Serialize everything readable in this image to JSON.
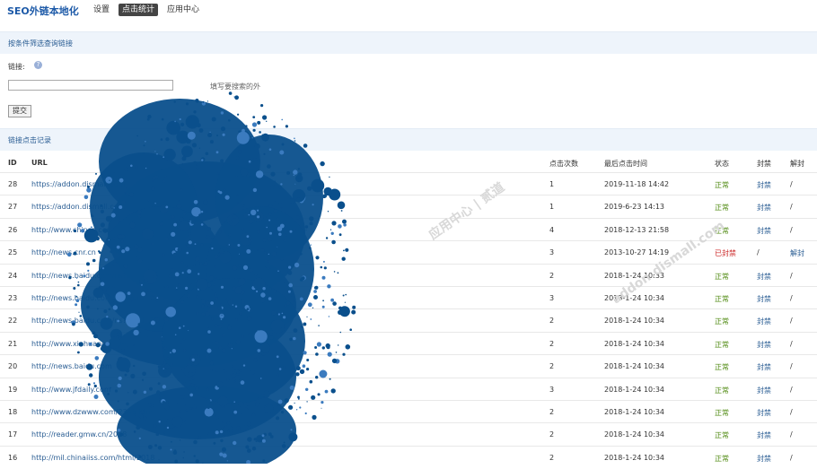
{
  "app": {
    "logo_prefix": "SEO",
    "logo_rest": "外链本地化"
  },
  "nav": {
    "items": [
      {
        "label": "设置",
        "active": false
      },
      {
        "label": "点击统计",
        "active": true
      },
      {
        "label": "应用中心",
        "active": false
      }
    ]
  },
  "filter": {
    "section_title": "按条件筛选查询链接",
    "link_label": "链接:",
    "input_value": "",
    "hint": "填写要搜索的外",
    "submit_label": "提交"
  },
  "records": {
    "section_title": "链接点击记录",
    "columns": [
      "ID",
      "URL",
      "点击次数",
      "最后点击时间",
      "状态",
      "封禁",
      "解封"
    ],
    "rows": [
      {
        "id": "28",
        "url": "https://addon.dismall.com",
        "clicks": "1",
        "last": "2019-11-18 14:42",
        "status": "正常",
        "status_type": "ok",
        "ban": "封禁",
        "unban": "/"
      },
      {
        "id": "27",
        "url": "https://addon.dismall.com",
        "clicks": "1",
        "last": "2019-6-23 14:13",
        "status": "正常",
        "status_type": "ok",
        "ban": "封禁",
        "unban": "/"
      },
      {
        "id": "26",
        "url": "http://www.chinaz.com",
        "clicks": "4",
        "last": "2018-12-13 21:58",
        "status": "正常",
        "status_type": "ok",
        "ban": "封禁",
        "unban": "/"
      },
      {
        "id": "25",
        "url": "http://news.cnr.cn",
        "clicks": "3",
        "last": "2013-10-27 14:19",
        "status": "已封禁",
        "status_type": "banned",
        "ban": "/",
        "unban": "解封"
      },
      {
        "id": "24",
        "url": "http://news.baidu.com/ns?word=%C4%B4%A8%2..",
        "clicks": "2",
        "last": "2018-1-24 10:33",
        "status": "正常",
        "status_type": "ok",
        "ban": "封禁",
        "unban": "/"
      },
      {
        "id": "23",
        "url": "http://news.baidu.com/ns?word=%E3%BB%C6%D..",
        "clicks": "3",
        "last": "2018-1-24 10:34",
        "status": "正常",
        "status_type": "ok",
        "ban": "封禁",
        "unban": "/"
      },
      {
        "id": "22",
        "url": "http://news.baidu.com/ns?word=%D0%C2%BF%EC%B..",
        "clicks": "2",
        "last": "2018-1-24 10:34",
        "status": "正常",
        "status_type": "ok",
        "ban": "封禁",
        "unban": "/"
      },
      {
        "id": "21",
        "url": "http://www.xinhuanet.com",
        "clicks": "2",
        "last": "2018-1-24 10:34",
        "status": "正常",
        "status_type": "ok",
        "ban": "封禁",
        "unban": "/"
      },
      {
        "id": "20",
        "url": "http://news.baidu.com",
        "clicks": "2",
        "last": "2018-1-24 10:34",
        "status": "正常",
        "status_type": "ok",
        "ban": "封禁",
        "unban": "/"
      },
      {
        "id": "19",
        "url": "http://www.jfdaily.com",
        "clicks": "3",
        "last": "2018-1-24 10:34",
        "status": "正常",
        "status_type": "ok",
        "ban": "封禁",
        "unban": "/"
      },
      {
        "id": "18",
        "url": "http://www.dzwww.com/2345.htm",
        "clicks": "2",
        "last": "2018-1-24 10:34",
        "status": "正常",
        "status_type": "ok",
        "ban": "封禁",
        "unban": "/"
      },
      {
        "id": "17",
        "url": "http://reader.gmw.cn/2018",
        "clicks": "2",
        "last": "2018-1-24 10:34",
        "status": "正常",
        "status_type": "ok",
        "ban": "封禁",
        "unban": "/"
      },
      {
        "id": "16",
        "url": "http://mil.chinaiiss.com/html/2018",
        "clicks": "2",
        "last": "2018-1-24 10:34",
        "status": "正常",
        "status_type": "ok",
        "ban": "封禁",
        "unban": "/"
      }
    ]
  },
  "watermarks": [
    "应用中心 | 贰道",
    "addon.dismall.com"
  ],
  "colors": {
    "accent": "#1d5aa8",
    "link": "#2a5d93",
    "ok": "#4f8a10",
    "banned": "#cc2a2a",
    "splatter": "#0a4f8c"
  }
}
